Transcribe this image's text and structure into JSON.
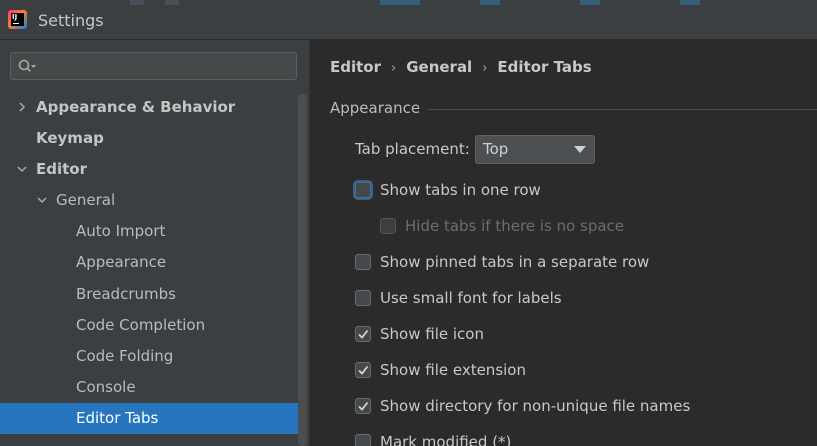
{
  "window": {
    "title": "Settings"
  },
  "search": {
    "value": "",
    "placeholder": ""
  },
  "tree": [
    {
      "label": "Appearance & Behavior",
      "bold": true,
      "expander": "collapsed"
    },
    {
      "label": "Keymap",
      "bold": true,
      "expander": "none"
    },
    {
      "label": "Editor",
      "bold": true,
      "expander": "expanded"
    },
    {
      "label": "General",
      "bold": false,
      "expander": "expanded"
    },
    {
      "label": "Auto Import",
      "bold": false,
      "expander": "none"
    },
    {
      "label": "Appearance",
      "bold": false,
      "expander": "none"
    },
    {
      "label": "Breadcrumbs",
      "bold": false,
      "expander": "none"
    },
    {
      "label": "Code Completion",
      "bold": false,
      "expander": "none"
    },
    {
      "label": "Code Folding",
      "bold": false,
      "expander": "none"
    },
    {
      "label": "Console",
      "bold": false,
      "expander": "none"
    },
    {
      "label": "Editor Tabs",
      "bold": false,
      "expander": "none",
      "selected": true
    }
  ],
  "breadcrumb": [
    "Editor",
    "General",
    "Editor Tabs"
  ],
  "section": {
    "title": "Appearance"
  },
  "tab_placement": {
    "label": "Tab placement:",
    "value": "Top"
  },
  "options": [
    {
      "label": "Show tabs in one row",
      "checked": false,
      "enabled": true,
      "focused": true
    },
    {
      "label": "Hide tabs if there is no space",
      "checked": false,
      "enabled": false
    },
    {
      "label": "Show pinned tabs in a separate row",
      "checked": false,
      "enabled": true
    },
    {
      "label": "Use small font for labels",
      "checked": false,
      "enabled": true
    },
    {
      "label": "Show file icon",
      "checked": true,
      "enabled": true
    },
    {
      "label": "Show file extension",
      "checked": true,
      "enabled": true
    },
    {
      "label": "Show directory for non-unique file names",
      "checked": true,
      "enabled": true
    },
    {
      "label": "Mark modified (*)",
      "checked": false,
      "enabled": true
    }
  ],
  "colors": {
    "selection": "#2675bf",
    "panel": "#3c3f41",
    "content": "#2b2b2b"
  }
}
